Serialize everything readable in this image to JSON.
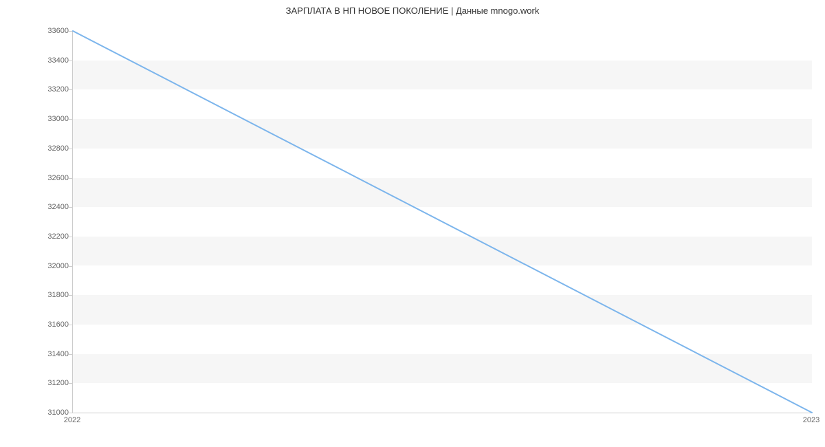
{
  "chart_data": {
    "type": "line",
    "title": "ЗАРПЛАТА В НП НОВОЕ ПОКОЛЕНИЕ | Данные mnogo.work",
    "x": [
      "2022",
      "2023"
    ],
    "values": [
      33600,
      31000
    ],
    "xlabel": "",
    "ylabel": "",
    "ylim": [
      31000,
      33600
    ],
    "y_ticks": [
      31000,
      31200,
      31400,
      31600,
      31800,
      32000,
      32200,
      32400,
      32600,
      32800,
      33000,
      33200,
      33400,
      33600
    ],
    "line_color": "#7cb5ec"
  },
  "x_ticks": {
    "t0": "2022",
    "t1": "2023"
  },
  "y_tick_labels": {
    "l0": "31000",
    "l1": "31200",
    "l2": "31400",
    "l3": "31600",
    "l4": "31800",
    "l5": "32000",
    "l6": "32200",
    "l7": "32400",
    "l8": "32600",
    "l9": "32800",
    "l10": "33000",
    "l11": "33200",
    "l12": "33400",
    "l13": "33600"
  }
}
